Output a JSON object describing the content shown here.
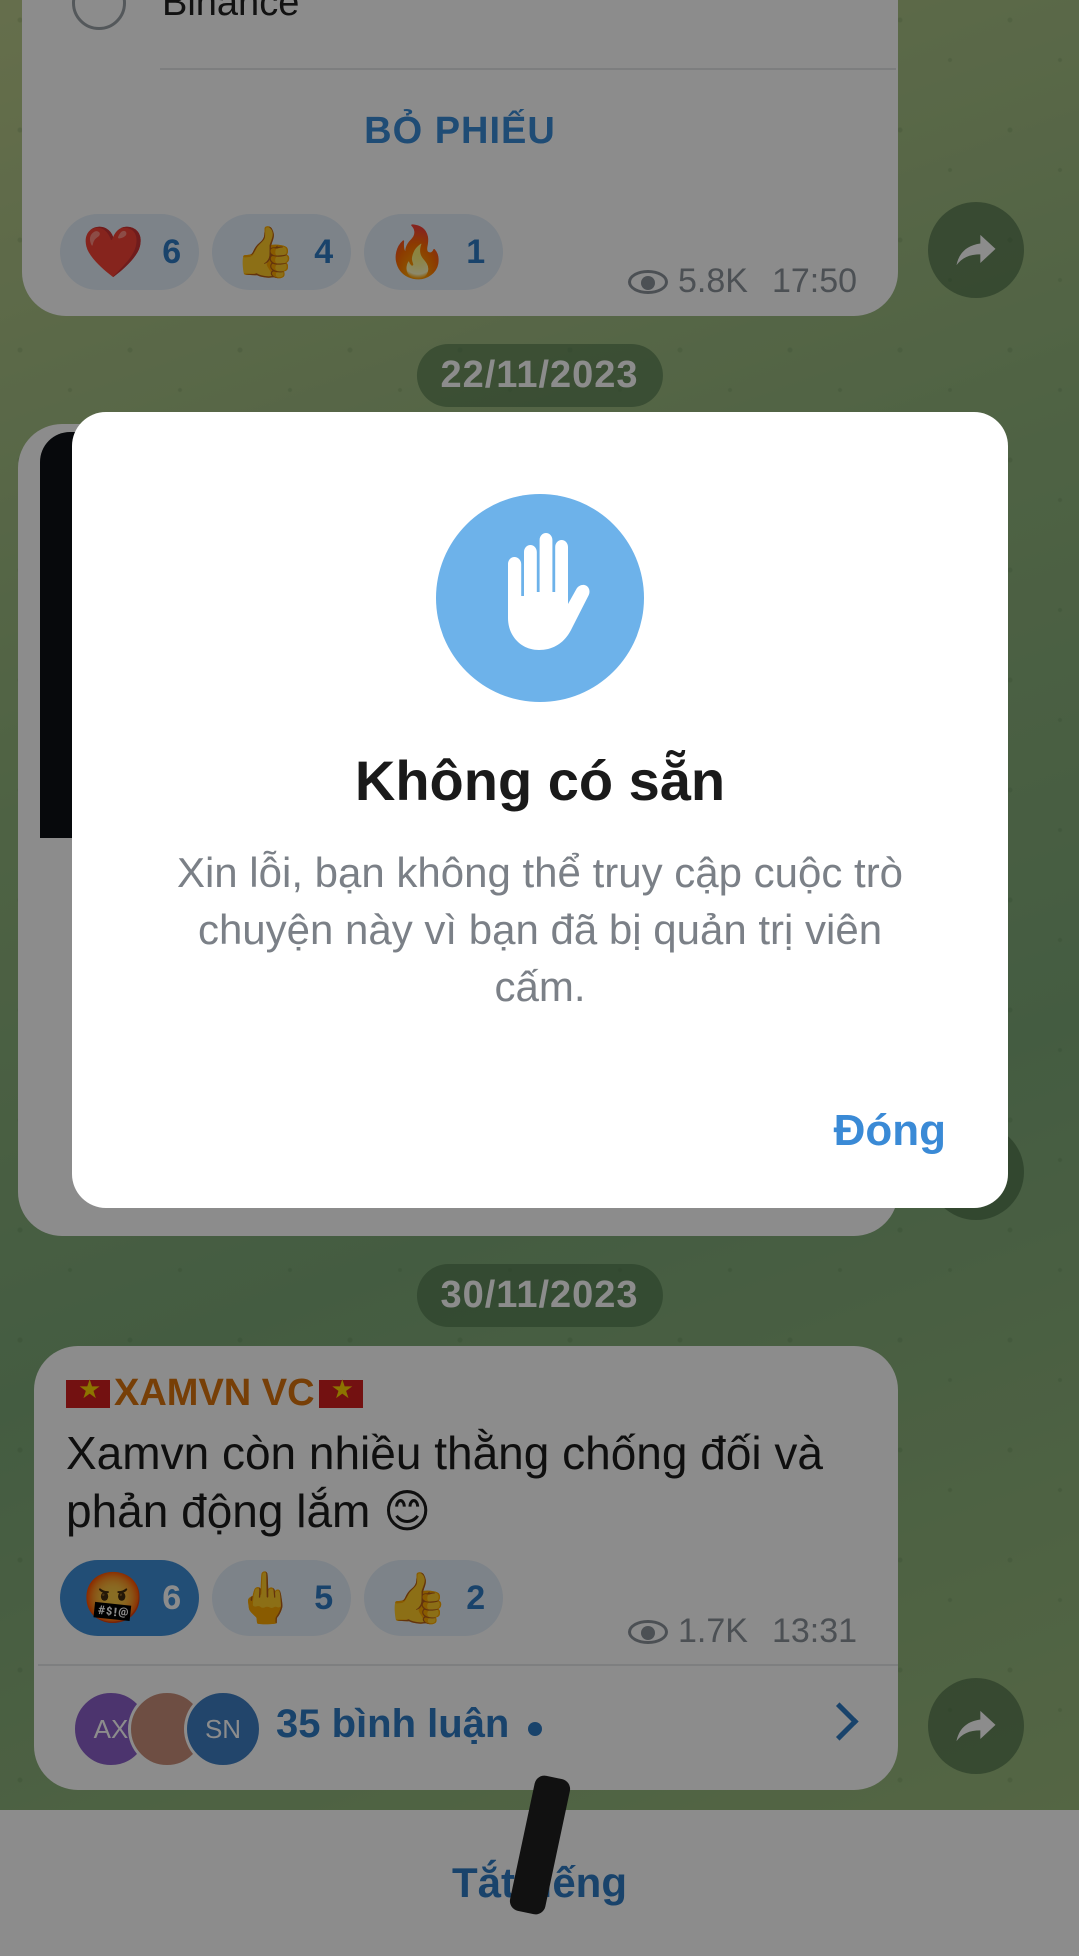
{
  "poll": {
    "option_label": "Binance",
    "vote_button": "BỎ PHIẾU",
    "reactions": [
      {
        "emoji": "❤️",
        "count": "6"
      },
      {
        "emoji": "👍",
        "count": "4"
      },
      {
        "emoji": "🔥",
        "count": "1"
      }
    ],
    "views": "5.8K",
    "time": "17:50"
  },
  "dates": {
    "first": "22/11/2023",
    "second": "30/11/2023"
  },
  "message": {
    "sender": "XAMVN VC",
    "text": "Xamvn còn nhiều thằng chống đối và phản động lắm 😊",
    "reactions": [
      {
        "emoji": "🤬",
        "count": "6",
        "selected": true
      },
      {
        "emoji": "🖕",
        "count": "5",
        "selected": false
      },
      {
        "emoji": "👍",
        "count": "2",
        "selected": false
      }
    ],
    "views": "1.7K",
    "time": "13:31",
    "comments": {
      "avatars": [
        "AX",
        "",
        "SN"
      ],
      "label": "35 bình luận"
    }
  },
  "bottom_bar": {
    "mute_label": "Tắt tiếng"
  },
  "dialog": {
    "icon": "hand-stop-icon",
    "title": "Không có sẵn",
    "body": "Xin lỗi, bạn không thể truy cập cuộc trò chuyện này vì bạn đã bị quản trị viên cấm.",
    "close_button": "Đóng"
  },
  "colors": {
    "accent": "#3a8ad6",
    "dialog_icon_bg": "#6db2ea",
    "sender_name": "#d9730d"
  }
}
